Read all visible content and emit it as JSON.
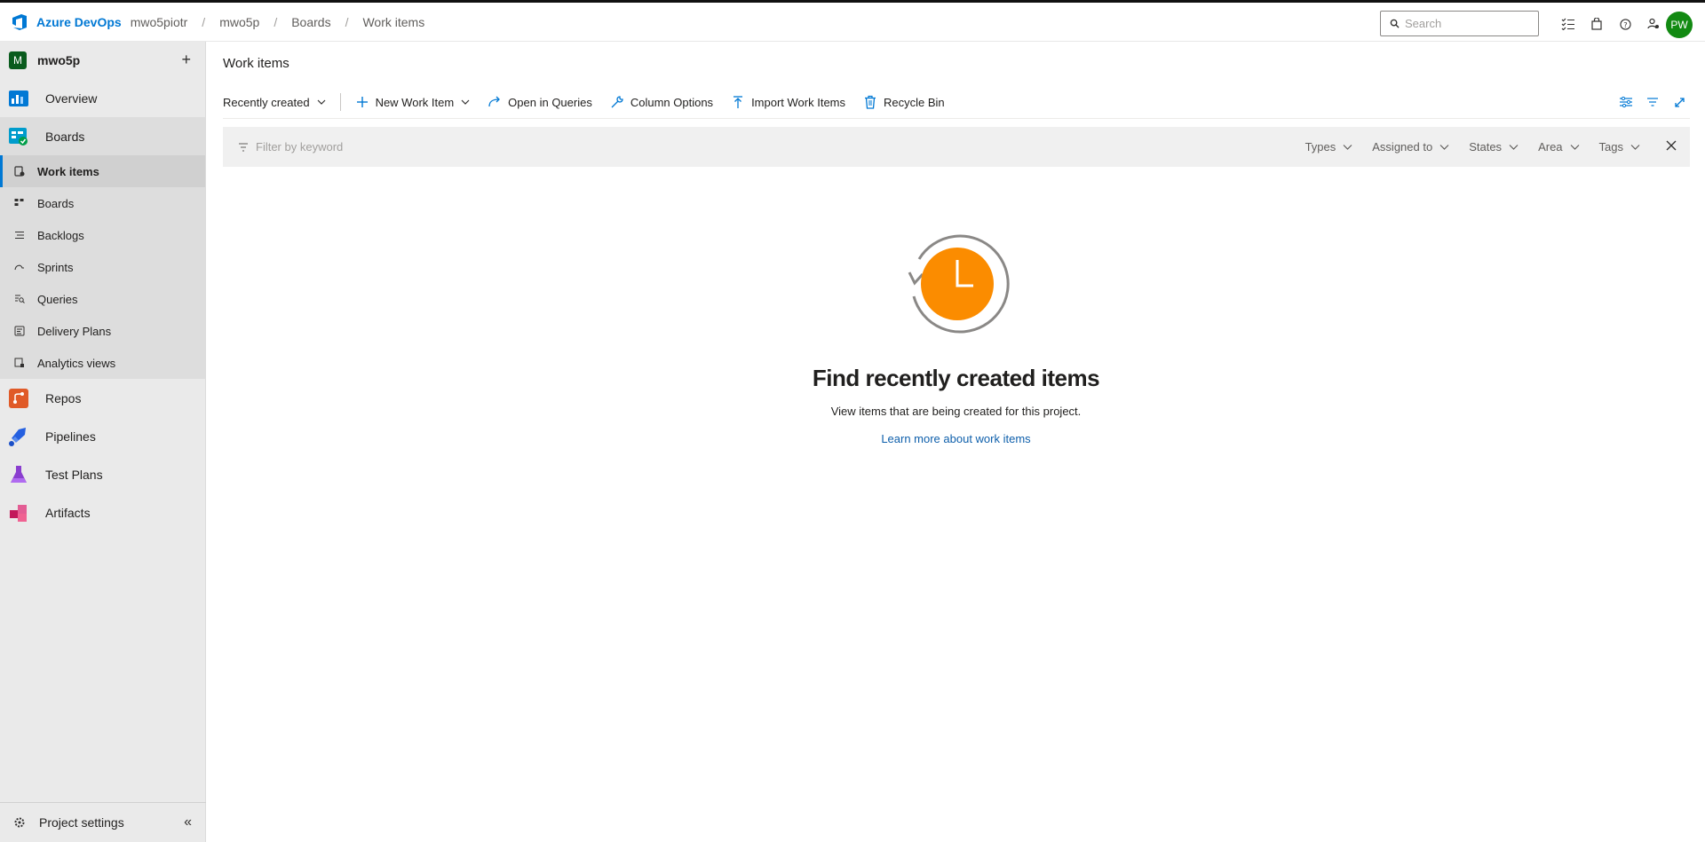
{
  "header": {
    "brand": "Azure DevOps",
    "breadcrumbs": [
      "mwo5piotr",
      "mwo5p",
      "Boards",
      "Work items"
    ],
    "search_placeholder": "Search",
    "avatar_initials": "PW",
    "avatar_color": "#128a12",
    "icons": [
      "task-list-icon",
      "shopping-bag-icon",
      "help-icon",
      "user-settings-icon"
    ]
  },
  "sidebar": {
    "project_initial": "M",
    "project_name": "mwo5p",
    "items": [
      {
        "label": "Overview",
        "icon": "overview-icon"
      },
      {
        "label": "Boards",
        "icon": "boards-icon"
      },
      {
        "label": "Repos",
        "icon": "repos-icon"
      },
      {
        "label": "Pipelines",
        "icon": "pipelines-icon"
      },
      {
        "label": "Test Plans",
        "icon": "test-plans-icon"
      },
      {
        "label": "Artifacts",
        "icon": "artifacts-icon"
      }
    ],
    "boards_sub": [
      {
        "label": "Work items",
        "icon": "work-items-icon",
        "active": true
      },
      {
        "label": "Boards",
        "icon": "kanban-icon"
      },
      {
        "label": "Backlogs",
        "icon": "backlog-icon"
      },
      {
        "label": "Sprints",
        "icon": "sprint-icon"
      },
      {
        "label": "Queries",
        "icon": "query-icon"
      },
      {
        "label": "Delivery Plans",
        "icon": "delivery-plans-icon"
      },
      {
        "label": "Analytics views",
        "icon": "analytics-icon"
      }
    ],
    "settings_label": "Project settings"
  },
  "main": {
    "title": "Work items",
    "view_selector": "Recently created",
    "toolbar": {
      "new_item": "New Work Item",
      "open_queries": "Open in Queries",
      "column_options": "Column Options",
      "import": "Import Work Items",
      "recycle": "Recycle Bin"
    },
    "filter": {
      "placeholder": "Filter by keyword",
      "dropdowns": [
        "Types",
        "Assigned to",
        "States",
        "Area",
        "Tags"
      ]
    },
    "empty_state": {
      "title": "Find recently created items",
      "description": "View items that are being created for this project.",
      "link": "Learn more about work items"
    }
  },
  "colors": {
    "accent": "#0078d4",
    "clock_orange": "#fb8c00",
    "sidebar_bg": "#eaeaea"
  }
}
